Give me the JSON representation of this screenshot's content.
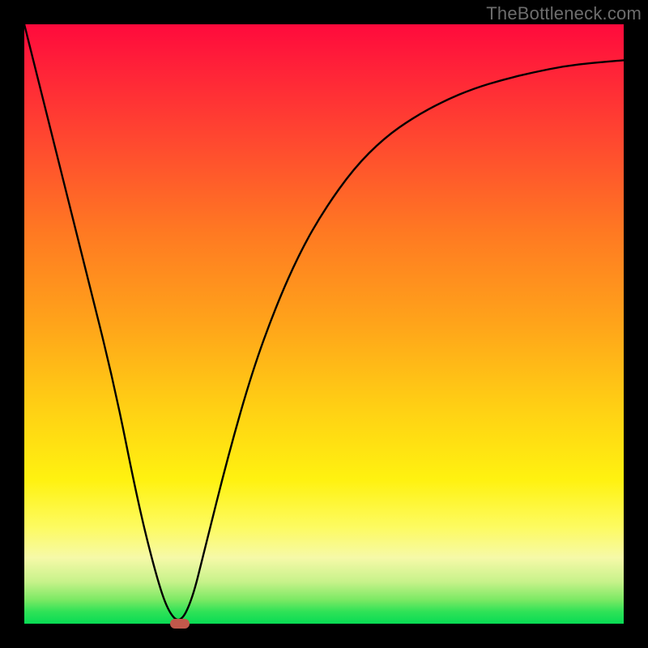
{
  "watermark": "TheBottleneck.com",
  "chart_data": {
    "type": "line",
    "title": "",
    "xlabel": "",
    "ylabel": "",
    "xlim": [
      0,
      100
    ],
    "ylim": [
      0,
      100
    ],
    "series": [
      {
        "name": "bottleneck-curve",
        "x": [
          0,
          5,
          10,
          15,
          19,
          22,
          24,
          26,
          28,
          30,
          34,
          38,
          42,
          46,
          50,
          55,
          60,
          65,
          70,
          75,
          80,
          85,
          90,
          95,
          100
        ],
        "y": [
          100,
          80,
          60,
          40,
          20,
          8,
          2,
          0,
          4,
          12,
          28,
          42,
          53,
          62,
          69,
          76,
          81,
          84.5,
          87.2,
          89.3,
          90.8,
          92,
          93,
          93.6,
          94
        ]
      }
    ],
    "marker": {
      "x": 26,
      "y": 0
    }
  }
}
